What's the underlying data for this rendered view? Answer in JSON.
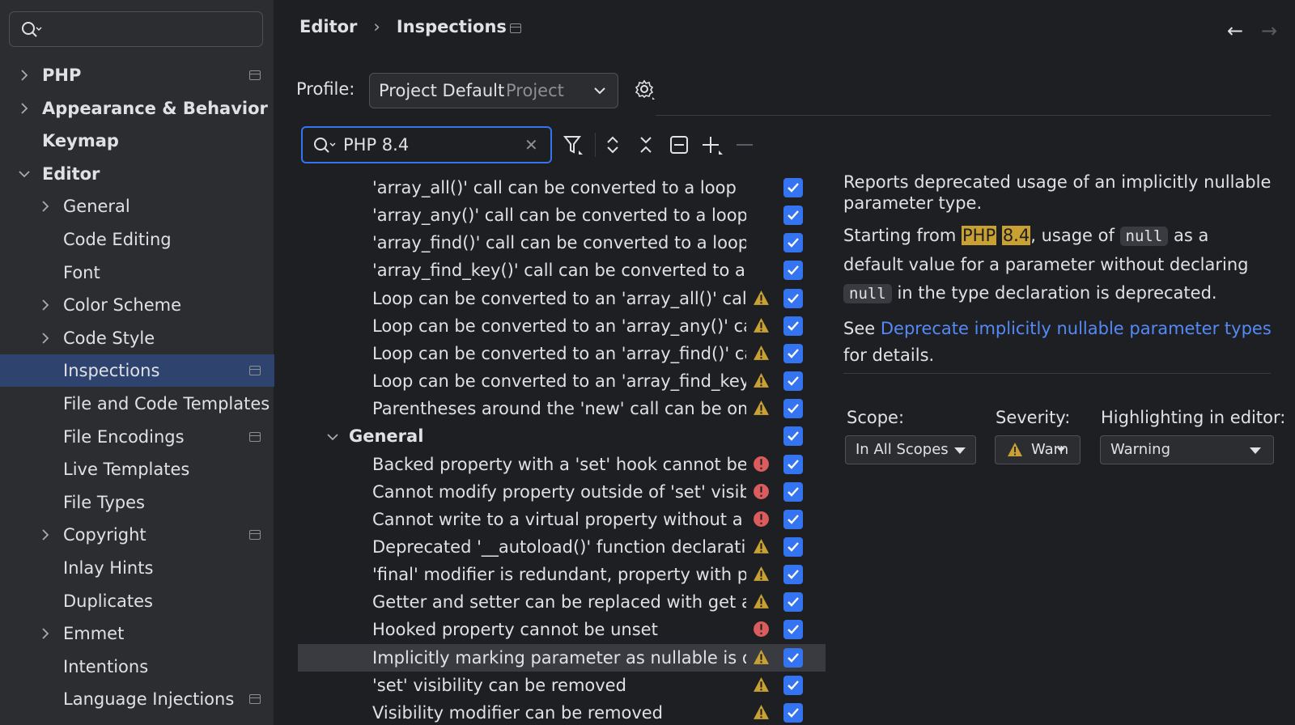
{
  "sidebar": {
    "search_placeholder": "",
    "items": [
      {
        "label": "PHP",
        "indent": 0,
        "chevron": "right",
        "bold": true,
        "pinned": true
      },
      {
        "label": "Appearance & Behavior",
        "indent": 0,
        "chevron": "right",
        "bold": true,
        "pinned": false
      },
      {
        "label": "Keymap",
        "indent": 0,
        "chevron": "none",
        "bold": true,
        "pinned": false
      },
      {
        "label": "Editor",
        "indent": 0,
        "chevron": "down",
        "bold": true,
        "pinned": false
      },
      {
        "label": "General",
        "indent": 1,
        "chevron": "right",
        "bold": false,
        "pinned": false
      },
      {
        "label": "Code Editing",
        "indent": 1,
        "chevron": "none",
        "bold": false,
        "pinned": false
      },
      {
        "label": "Font",
        "indent": 1,
        "chevron": "none",
        "bold": false,
        "pinned": false
      },
      {
        "label": "Color Scheme",
        "indent": 1,
        "chevron": "right",
        "bold": false,
        "pinned": false
      },
      {
        "label": "Code Style",
        "indent": 1,
        "chevron": "right",
        "bold": false,
        "pinned": false
      },
      {
        "label": "Inspections",
        "indent": 1,
        "chevron": "none",
        "bold": false,
        "pinned": true,
        "selected": true
      },
      {
        "label": "File and Code Templates",
        "indent": 1,
        "chevron": "none",
        "bold": false,
        "pinned": false
      },
      {
        "label": "File Encodings",
        "indent": 1,
        "chevron": "none",
        "bold": false,
        "pinned": true
      },
      {
        "label": "Live Templates",
        "indent": 1,
        "chevron": "none",
        "bold": false,
        "pinned": false
      },
      {
        "label": "File Types",
        "indent": 1,
        "chevron": "none",
        "bold": false,
        "pinned": false
      },
      {
        "label": "Copyright",
        "indent": 1,
        "chevron": "right",
        "bold": false,
        "pinned": true
      },
      {
        "label": "Inlay Hints",
        "indent": 1,
        "chevron": "none",
        "bold": false,
        "pinned": false
      },
      {
        "label": "Duplicates",
        "indent": 1,
        "chevron": "none",
        "bold": false,
        "pinned": false
      },
      {
        "label": "Emmet",
        "indent": 1,
        "chevron": "right",
        "bold": false,
        "pinned": false
      },
      {
        "label": "Intentions",
        "indent": 1,
        "chevron": "none",
        "bold": false,
        "pinned": false
      },
      {
        "label": "Language Injections",
        "indent": 1,
        "chevron": "none",
        "bold": false,
        "pinned": true
      }
    ]
  },
  "header": {
    "breadcrumb": [
      "Editor",
      "Inspections"
    ],
    "separator": "›"
  },
  "profile": {
    "label": "Profile:",
    "name": "Project Default",
    "scope": "Project"
  },
  "search": {
    "value": "PHP 8.4"
  },
  "tree": {
    "rows": [
      {
        "label": "'array_all()' call can be converted to a loop",
        "severity": "none",
        "checked": true
      },
      {
        "label": "'array_any()' call can be converted to a loop",
        "severity": "none",
        "checked": true
      },
      {
        "label": "'array_find()' call can be converted to a loop",
        "severity": "none",
        "checked": true
      },
      {
        "label": "'array_find_key()' call can be converted to a loop",
        "severity": "none",
        "checked": true
      },
      {
        "label": "Loop can be converted to an 'array_all()' call",
        "severity": "warning",
        "checked": true
      },
      {
        "label": "Loop can be converted to an 'array_any()' call",
        "severity": "warning",
        "checked": true
      },
      {
        "label": "Loop can be converted to an 'array_find()' call",
        "severity": "warning",
        "checked": true
      },
      {
        "label": "Loop can be converted to an 'array_find_key()' call",
        "severity": "warning",
        "checked": true
      },
      {
        "label": "Parentheses around the 'new' call can be omitted",
        "severity": "warning",
        "checked": true
      },
      {
        "label": "General",
        "group": true,
        "severity": "none",
        "checked": true
      },
      {
        "label": "Backed property with a 'set' hook cannot be accessed",
        "severity": "error",
        "checked": true
      },
      {
        "label": "Cannot modify property outside of 'set' visibility",
        "severity": "error",
        "checked": true
      },
      {
        "label": "Cannot write to a virtual property without a setter",
        "severity": "error",
        "checked": true
      },
      {
        "label": "Deprecated '__autoload()' function declaration",
        "severity": "warning",
        "checked": true
      },
      {
        "label": "'final' modifier is redundant, property with private",
        "severity": "warning",
        "checked": true
      },
      {
        "label": "Getter and setter can be replaced with get and set",
        "severity": "warning",
        "checked": true
      },
      {
        "label": "Hooked property cannot be unset",
        "severity": "error",
        "checked": true
      },
      {
        "label": "Implicitly marking parameter as nullable is deprecated",
        "severity": "warning",
        "checked": true,
        "selected": true
      },
      {
        "label": "'set' visibility can be removed",
        "severity": "warning",
        "checked": true
      },
      {
        "label": "Visibility modifier can be removed",
        "severity": "warning",
        "checked": true
      }
    ]
  },
  "description": {
    "p1": "Reports deprecated usage of an implicitly nullable parameter type.",
    "p2_a": "Starting from ",
    "p2_hl1": "PHP",
    "p2_hl2": "8.4",
    "p2_b": ", usage of ",
    "p2_code1": "null",
    "p2_c": " as a default value for a parameter without declaring ",
    "p2_code2": "null",
    "p2_d": " in the type declaration is deprecated.",
    "p3_a": "See ",
    "p3_link": "Deprecate implicitly nullable parameter types",
    "p3_b": " for details."
  },
  "options": {
    "scope_label": "Scope:",
    "scope_value": "In All Scopes",
    "severity_label": "Severity:",
    "severity_value": "Warn",
    "highlighting_label": "Highlighting in editor:",
    "highlighting_value": "Warning"
  },
  "colors": {
    "accent": "#3574f0",
    "warning": "#c9a032",
    "error": "#db5c5c",
    "link": "#548af7"
  }
}
